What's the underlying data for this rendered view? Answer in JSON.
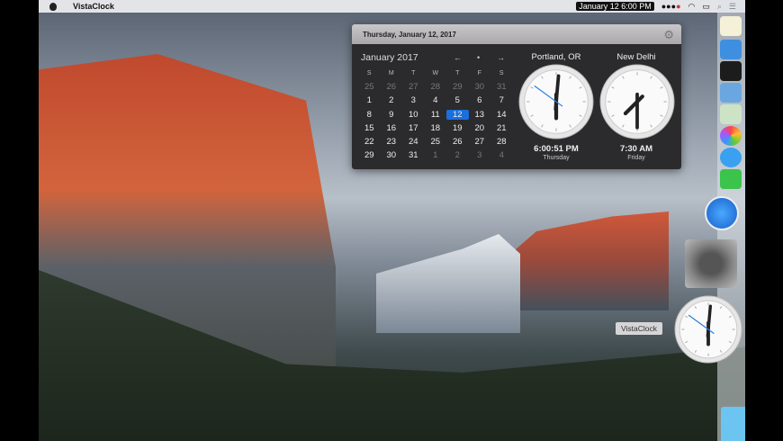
{
  "menubar": {
    "app_name": "VistaClock",
    "clock": "January 12  6:00 PM"
  },
  "panel": {
    "header_date": "Thursday, January 12, 2017",
    "calendar": {
      "month_title": "January 2017",
      "prev": "←",
      "today": "•",
      "next": "→",
      "weekdays": [
        "S",
        "M",
        "T",
        "W",
        "T",
        "F",
        "S"
      ],
      "days": [
        "25",
        "26",
        "27",
        "28",
        "29",
        "30",
        "31",
        "1",
        "2",
        "3",
        "4",
        "5",
        "6",
        "7",
        "8",
        "9",
        "10",
        "11",
        "12",
        "13",
        "14",
        "15",
        "16",
        "17",
        "18",
        "19",
        "20",
        "21",
        "22",
        "23",
        "24",
        "25",
        "26",
        "27",
        "28",
        "29",
        "30",
        "31",
        "1",
        "2",
        "3",
        "4"
      ],
      "selected": "12"
    },
    "clocks": [
      {
        "city": "Portland, OR",
        "time": "6:00:51 PM",
        "day": "Thursday",
        "h": 18,
        "m": 0,
        "s": 51,
        "seconds": true
      },
      {
        "city": "New Delhi",
        "time": "7:30 AM",
        "day": "Friday",
        "h": 7,
        "m": 30,
        "s": 0,
        "seconds": false
      }
    ]
  },
  "dock": {
    "tooltip": "VistaClock"
  },
  "colors": {
    "accent": "#1a6fdc",
    "second_hand": "#2a7fe0"
  }
}
